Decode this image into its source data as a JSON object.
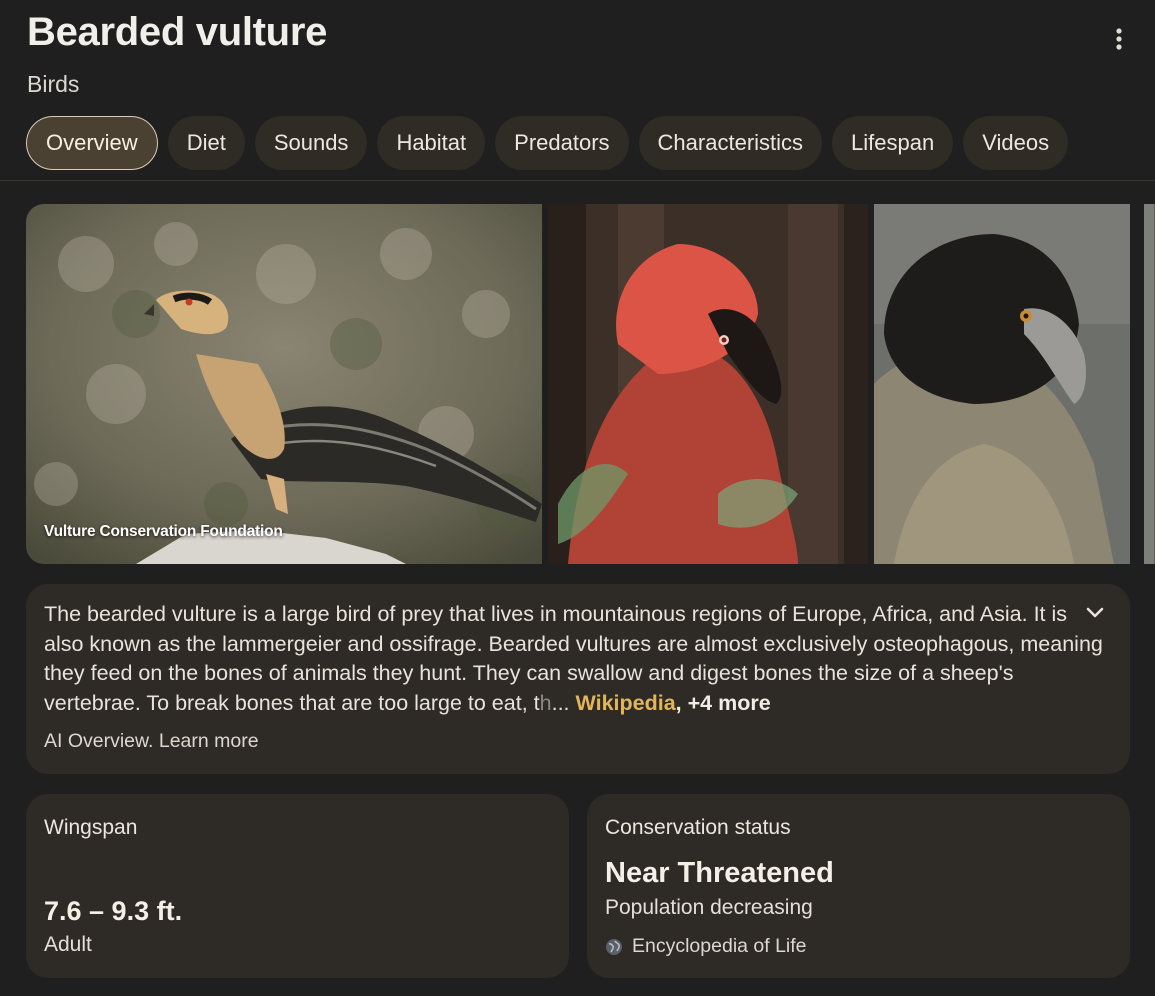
{
  "header": {
    "title": "Bearded vulture",
    "subtitle": "Birds"
  },
  "tabs": [
    {
      "label": "Overview",
      "active": true
    },
    {
      "label": "Diet"
    },
    {
      "label": "Sounds"
    },
    {
      "label": "Habitat"
    },
    {
      "label": "Predators"
    },
    {
      "label": "Characteristics"
    },
    {
      "label": "Lifespan"
    },
    {
      "label": "Videos"
    }
  ],
  "gallery": {
    "photo_credit": "Vulture Conservation Foundation"
  },
  "description": {
    "text": "The bearded vulture is a large bird of prey that lives in mountainous regions of Europe, Africa, and Asia. It is also known as the lammergeier and ossifrage. Bearded vultures are almost exclusively osteophagous, meaning they feed on the bones of animals they hunt. They can swallow and digest bones the size of a sheep's vertebrae. To break bones that are too large to eat, t",
    "faded_tail": "h",
    "ellipsis": "...",
    "source_link": "Wikipedia",
    "more_sources": ", +4 more",
    "ai_label": "AI Overview. Learn more"
  },
  "wingspan": {
    "label": "Wingspan",
    "value": "7.6 – 9.3 ft.",
    "qualifier": "Adult"
  },
  "conservation": {
    "label": "Conservation status",
    "value": "Near Threatened",
    "trend": "Population decreasing",
    "source": "Encyclopedia of Life"
  },
  "colors": {
    "background": "#1f1f1f",
    "card": "#2e2a25",
    "tab": "#2f2b25",
    "tab_active": "#4b4132",
    "link": "#e2b45c"
  }
}
